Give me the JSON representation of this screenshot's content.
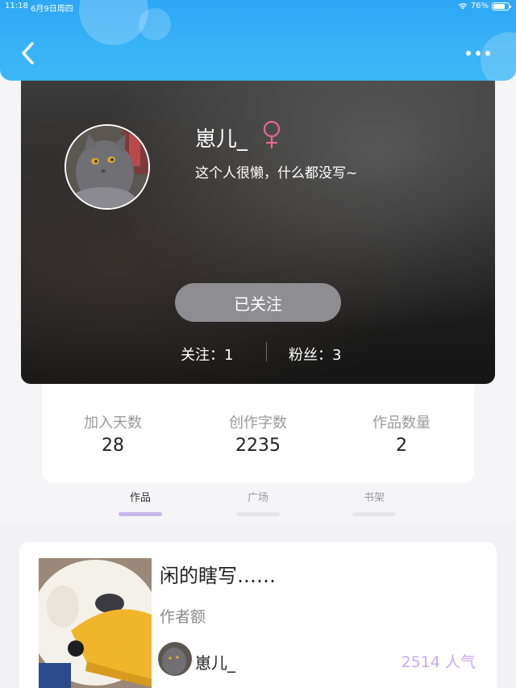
{
  "status_bar": {
    "time": "11:18",
    "date": "6月9日周四",
    "battery": "76%",
    "battery_level": 0.76
  },
  "header": {
    "back_icon": "chevron-left-icon",
    "more_icon": "more-dots-icon"
  },
  "profile": {
    "username": "崽儿_",
    "gender_icon": "female-symbol-icon",
    "gender_color": "#e86a8a",
    "bio": "这个人很懒，什么都没写~",
    "follow_button": "已关注",
    "following_label": "关注：1",
    "fans_label": "粉丝：3"
  },
  "stats": [
    {
      "label": "加入天数",
      "value": "28"
    },
    {
      "label": "创作字数",
      "value": "2235"
    },
    {
      "label": "作品数量",
      "value": "2"
    }
  ],
  "tabs": [
    {
      "label": "作品",
      "active": true
    },
    {
      "label": "广场",
      "active": false
    },
    {
      "label": "书架",
      "active": false
    }
  ],
  "works": [
    {
      "title": "闲的瞎写……",
      "author_label": "作者额",
      "author_name": "崽儿_",
      "popularity": "2514 人气"
    }
  ],
  "colors": {
    "header_blue": "#2ea7f6",
    "accent_purple": "#c8b6ec",
    "popularity_purple": "#c9aaf0",
    "follow_button_gray": "#8e8d92"
  }
}
